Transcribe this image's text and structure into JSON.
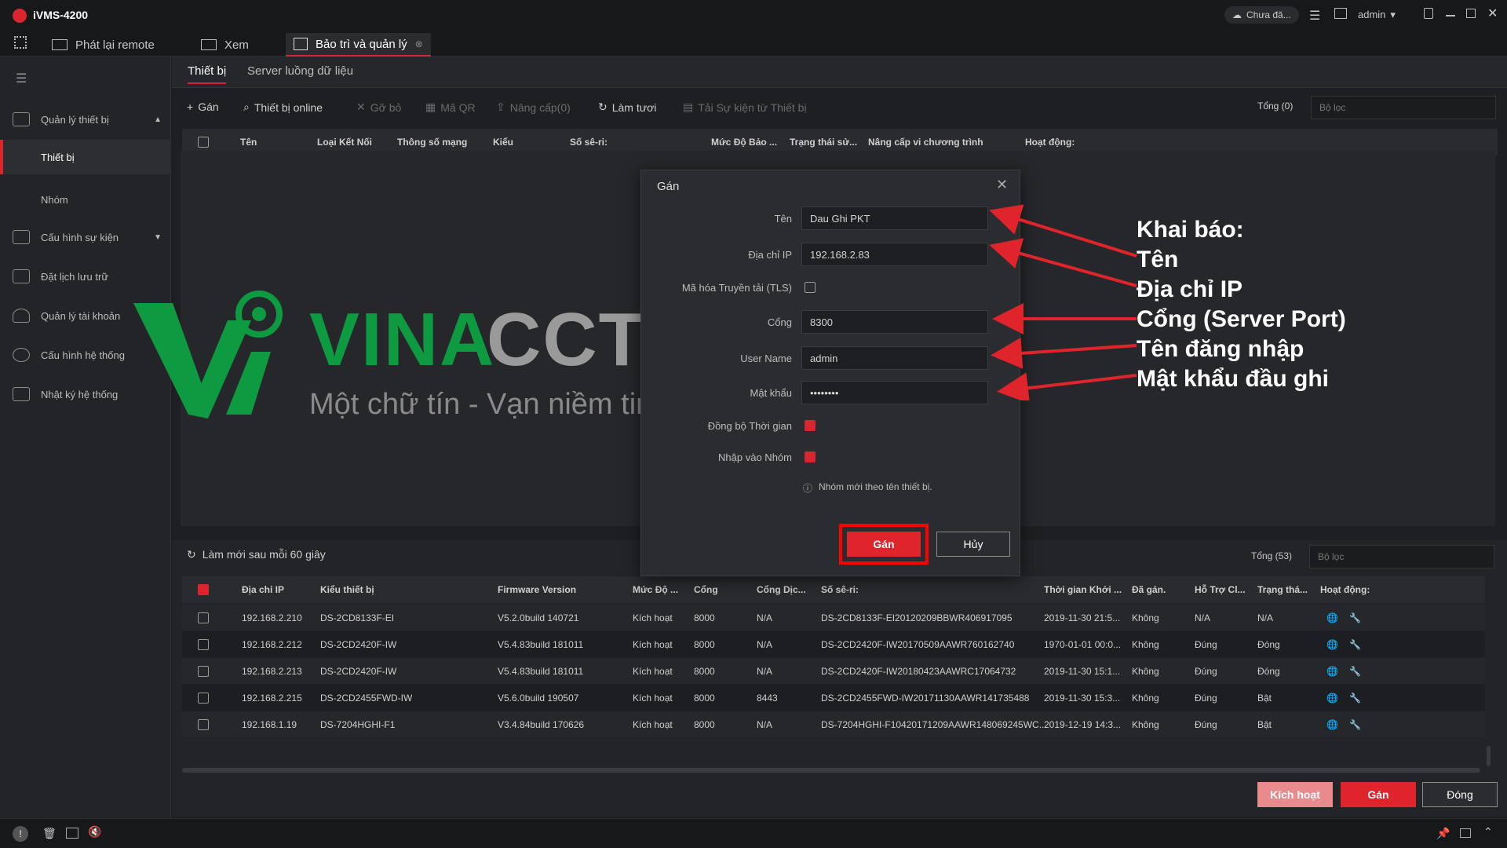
{
  "app": {
    "title": "iVMS-4200",
    "cloud_status": "Chưa đă...",
    "user": "admin"
  },
  "tabs": [
    {
      "label": "Phát lại remote"
    },
    {
      "label": "Xem"
    },
    {
      "label": "Bảo trì và quản lý"
    }
  ],
  "subtabs": [
    "Thiết bị",
    "Server luồng dữ liệu"
  ],
  "sidebar": {
    "items": [
      {
        "label": "Quản lý thiết bị"
      },
      {
        "label": "Thiết bị"
      },
      {
        "label": "Nhóm"
      },
      {
        "label": "Cấu hình sự kiện"
      },
      {
        "label": "Đặt lịch lưu trữ"
      },
      {
        "label": "Quản lý tài khoản"
      },
      {
        "label": "Cấu hình hệ thống"
      },
      {
        "label": "Nhật ký hệ thống"
      }
    ]
  },
  "toolbar": {
    "add": "Gán",
    "online": "Thiết bị online",
    "remove": "Gỡ bỏ",
    "qr": "Mã QR",
    "upgrade": "Nâng cấp(0)",
    "refresh": "Làm tươi",
    "export": "Tải Sự kiện từ Thiết bị",
    "total": "Tổng (0)",
    "filter_placeholder": "Bộ lọc"
  },
  "upper_columns": [
    "Tên",
    "Loại Kết Nối",
    "Thông số mạng",
    "Kiểu",
    "Số sê-ri:",
    "Mức Độ Bảo ...",
    "Trạng thái sử...",
    "Nâng cấp vi chương trình",
    "Hoạt động:"
  ],
  "watermark": {
    "brand_a": "VINA",
    "brand_b": "CCTV",
    "tagline": "Một chữ tín - Vạn niềm tin"
  },
  "dialog": {
    "title": "Gán",
    "fields": {
      "name_label": "Tên",
      "name_value": "Dau Ghi PKT",
      "ip_label": "Địa chỉ IP",
      "ip_value": "192.168.2.83",
      "tls_label": "Mã hóa Truyền tải (TLS)",
      "port_label": "Cổng",
      "port_value": "8300",
      "user_label": "User Name",
      "user_value": "admin",
      "pass_label": "Mật khẩu",
      "pass_value": "••••••••",
      "sync_label": "Đồng bộ Thời gian",
      "group_label": "Nhập vào Nhóm",
      "hint": "Nhóm mới theo tên thiết bị."
    },
    "add_button": "Gán",
    "cancel_button": "Hủy"
  },
  "annotation": [
    "Khai báo:",
    "Tên",
    "Địa chỉ IP",
    "Cổng (Server Port)",
    "Tên đăng nhập",
    "Mật khẩu đầu ghi"
  ],
  "lower": {
    "refresh_text": "Làm mới sau mỗi 60 giây",
    "total": "Tổng (53)",
    "filter_placeholder": "Bộ lọc",
    "columns": [
      "Địa chỉ IP",
      "Kiểu thiết bị",
      "Firmware Version",
      "Mức Độ ...",
      "Cổng",
      "Cổng Dịc...",
      "Số sê-ri:",
      "Thời gian Khởi ...",
      "Đã gán.",
      "Hỗ Trợ Cl...",
      "Trạng thá...",
      "Hoạt động:"
    ],
    "rows": [
      [
        "192.168.2.210",
        "DS-2CD8133F-EI",
        "V5.2.0build 140721",
        "Kích hoạt",
        "8000",
        "N/A",
        "DS-2CD8133F-EI20120209BBWR406917095",
        "2019-11-30 21:5...",
        "Không",
        "N/A",
        "N/A"
      ],
      [
        "192.168.2.212",
        "DS-2CD2420F-IW",
        "V5.4.83build 181011",
        "Kích hoạt",
        "8000",
        "N/A",
        "DS-2CD2420F-IW20170509AAWR760162740",
        "1970-01-01 00:0...",
        "Không",
        "Đúng",
        "Đóng"
      ],
      [
        "192.168.2.213",
        "DS-2CD2420F-IW",
        "V5.4.83build 181011",
        "Kích hoạt",
        "8000",
        "N/A",
        "DS-2CD2420F-IW20180423AAWRC17064732",
        "2019-11-30 15:1...",
        "Không",
        "Đúng",
        "Đóng"
      ],
      [
        "192.168.2.215",
        "DS-2CD2455FWD-IW",
        "V5.6.0build 190507",
        "Kích hoạt",
        "8000",
        "8443",
        "DS-2CD2455FWD-IW20171130AAWR141735488",
        "2019-11-30 15:3...",
        "Không",
        "Đúng",
        "Bật"
      ],
      [
        "192.168.1.19",
        "DS-7204HGHI-F1",
        "V3.4.84build 170626",
        "Kích hoạt",
        "8000",
        "N/A",
        "DS-7204HGHI-F10420171209AAWR148069245WC...",
        "2019-12-19 14:3...",
        "Không",
        "Đúng",
        "Bật"
      ]
    ],
    "activate_button": "Kích hoạt",
    "add_button": "Gán",
    "close_button": "Đóng"
  },
  "colors": {
    "accent": "#d9262e",
    "brand_green": "#0e9a41",
    "bg": "#1e1f22"
  }
}
